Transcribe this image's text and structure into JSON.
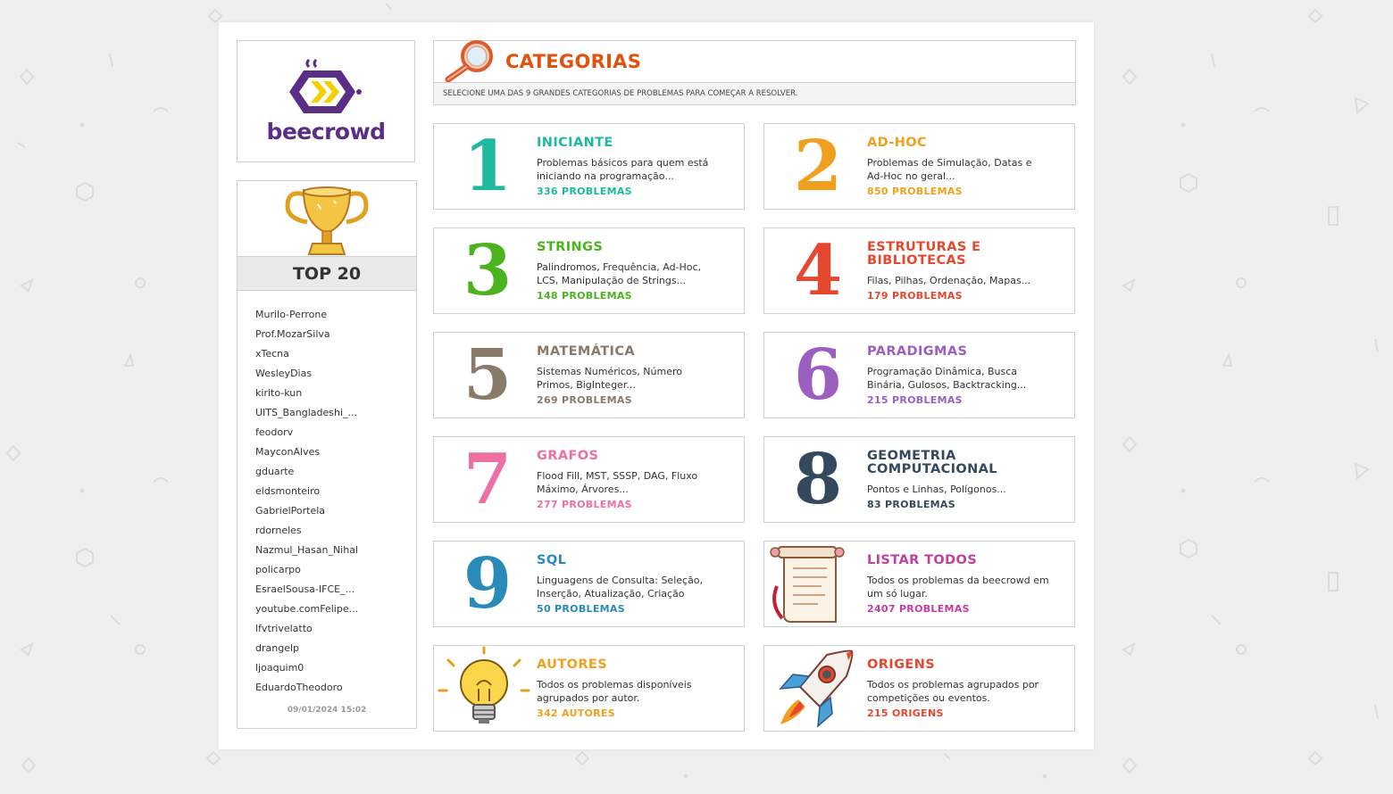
{
  "brand": {
    "name": "beecrowd"
  },
  "top": {
    "title": "TOP 20",
    "users": [
      "Murilo-Perrone",
      "Prof.MozarSilva",
      "xTecna",
      "WesleyDias",
      "kirito-kun",
      "UITS_Bangladeshi_...",
      "feodorv",
      "MayconAlves",
      "gduarte",
      "eldsmonteiro",
      "GabrielPortela",
      "rdorneles",
      "Nazmul_Hasan_Nihal",
      "policarpo",
      "EsraelSousa-IFCE_...",
      "youtube.comFelipe...",
      "lfvtrivelatto",
      "drangelp",
      "ljoaquim0",
      "EduardoTheodoro"
    ],
    "updated": "09/01/2024 15:02"
  },
  "header": {
    "title": "CATEGORIAS",
    "subtitle": "SELECIONE UMA DAS 9 GRANDES CATEGORIAS DE PROBLEMAS PARA COMEÇAR A RESOLVER."
  },
  "categories": [
    {
      "num": "1",
      "title": "INICIANTE",
      "desc": "Problemas básicos para quem está iniciando na programação...",
      "count": "336 PROBLEMAS",
      "color": "#1fb8a0"
    },
    {
      "num": "2",
      "title": "AD-HOC",
      "desc": "Problemas de Simulação, Datas e Ad-Hoc no geral...",
      "count": "850 PROBLEMAS",
      "color": "#f0a01e"
    },
    {
      "num": "3",
      "title": "STRINGS",
      "desc": "Palindromos, Frequência, Ad-Hoc, LCS, Manipulação de Strings...",
      "count": "148 PROBLEMAS",
      "color": "#4bb31e"
    },
    {
      "num": "4",
      "title": "ESTRUTURAS E BIBLIOTECAS",
      "desc": "Filas, Pilhas, Ordenação, Mapas...",
      "count": "179 PROBLEMAS",
      "color": "#e5472f"
    },
    {
      "num": "5",
      "title": "MATEMÁTICA",
      "desc": "Sistemas Numéricos, Número Primos, BigInteger...",
      "count": "269 PROBLEMAS",
      "color": "#8a7a6a"
    },
    {
      "num": "6",
      "title": "PARADIGMAS",
      "desc": "Programação Dinâmica, Busca Binária, Gulosos, Backtracking...",
      "count": "215 PROBLEMAS",
      "color": "#9b5fc0"
    },
    {
      "num": "7",
      "title": "GRAFOS",
      "desc": "Flood Fill, MST, SSSP, DAG, Fluxo Máximo, Árvores...",
      "count": "277 PROBLEMAS",
      "color": "#ee6fa3"
    },
    {
      "num": "8",
      "title": "GEOMETRIA COMPUTACIONAL",
      "desc": "Pontos e Linhas, Polígonos...",
      "count": "83 PROBLEMAS",
      "color": "#34495e"
    },
    {
      "num": "9",
      "title": "SQL",
      "desc": "Linguagens de Consulta: Seleção, Inserção, Atualização, Criação",
      "count": "50 PROBLEMAS",
      "color": "#2a8ab8"
    },
    {
      "num": "",
      "title": "LISTAR TODOS",
      "desc": "Todos os problemas da beecrowd em um só lugar.",
      "count": "2407 PROBLEMAS",
      "color": "#c23fa0",
      "icon": "scroll-icon"
    },
    {
      "num": "",
      "title": "AUTORES",
      "desc": "Todos os problemas disponíveis agrupados por autor.",
      "count": "342 AUTORES",
      "color": "#f0a01e",
      "icon": "lightbulb-icon"
    },
    {
      "num": "",
      "title": "ORIGENS",
      "desc": "Todos os problemas agrupados por competições ou eventos.",
      "count": "215 ORIGENS",
      "color": "#e5472f",
      "icon": "rocket-icon"
    }
  ]
}
